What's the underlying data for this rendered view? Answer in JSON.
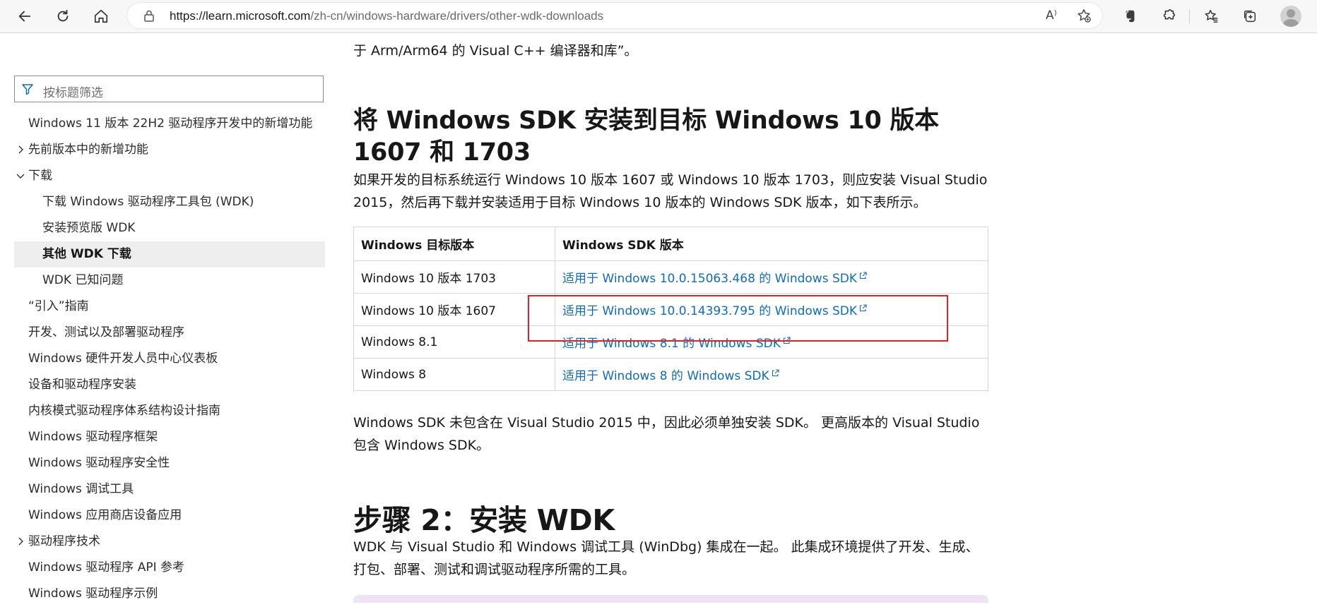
{
  "browser": {
    "url_host": "https://learn.microsoft.com",
    "url_path": "/zh-cn/windows-hardware/drivers/other-wdk-downloads",
    "read_aloud_label": "A⁾"
  },
  "sidebar": {
    "filter_placeholder": "按标题筛选",
    "items": [
      {
        "label": "Windows 11 版本 22H2 驱动程序开发中的新增功能"
      },
      {
        "label": "先前版本中的新增功能"
      },
      {
        "label": "下载"
      },
      {
        "label": "下载 Windows 驱动程序工具包 (WDK)"
      },
      {
        "label": "安装预览版 WDK"
      },
      {
        "label": "其他 WDK 下载"
      },
      {
        "label": "WDK 已知问题"
      },
      {
        "label": "“引入”指南"
      },
      {
        "label": "开发、测试以及部署驱动程序"
      },
      {
        "label": "Windows 硬件开发人员中心仪表板"
      },
      {
        "label": "设备和驱动程序安装"
      },
      {
        "label": "内核模式驱动程序体系结构设计指南"
      },
      {
        "label": "Windows 驱动程序框架"
      },
      {
        "label": "Windows 驱动程序安全性"
      },
      {
        "label": "Windows 调试工具"
      },
      {
        "label": "Windows 应用商店设备应用"
      },
      {
        "label": "驱动程序技术"
      },
      {
        "label": "Windows 驱动程序 API 参考"
      },
      {
        "label": "Windows 驱动程序示例"
      }
    ]
  },
  "content": {
    "top_line": "于 Arm/Arm64 的 Visual C++ 编译器和库”。",
    "heading1": "将 Windows SDK 安装到目标 Windows 10 版本 1607 和 1703",
    "para1": "如果开发的目标系统运行 Windows 10 版本 1607 或 Windows 10 版本 1703，则应安装 Visual Studio 2015，然后再下载并安装适用于目标 Windows 10 版本的 Windows SDK 版本，如下表所示。",
    "table": {
      "headers": [
        "Windows 目标版本",
        "Windows SDK 版本"
      ],
      "rows": [
        {
          "target": "Windows 10 版本 1703",
          "sdk": "适用于 Windows 10.0.15063.468 的 Windows SDK"
        },
        {
          "target": "Windows 10 版本 1607",
          "sdk": "适用于 Windows 10.0.14393.795 的 Windows SDK"
        },
        {
          "target": "Windows 8.1",
          "sdk": "适用于 Windows 8.1 的 Windows SDK"
        },
        {
          "target": "Windows 8",
          "sdk": "适用于 Windows 8 的 Windows SDK"
        }
      ]
    },
    "para2": "Windows SDK 未包含在 Visual Studio 2015 中，因此必须单独安装 SDK。 更高版本的 Visual Studio 包含 Windows SDK。",
    "heading2": "步骤 2：安装 WDK",
    "para3": "WDK 与 Visual Studio 和 Windows 调试工具 (WinDbg) 集成在一起。 此集成环境提供了开发、生成、打包、部署、测试和调试驱动程序所需的工具。"
  },
  "colors": {
    "link": "#0f6cbd",
    "highlight_box": "#e3202a",
    "active_nav_bg": "#eeeeee"
  }
}
